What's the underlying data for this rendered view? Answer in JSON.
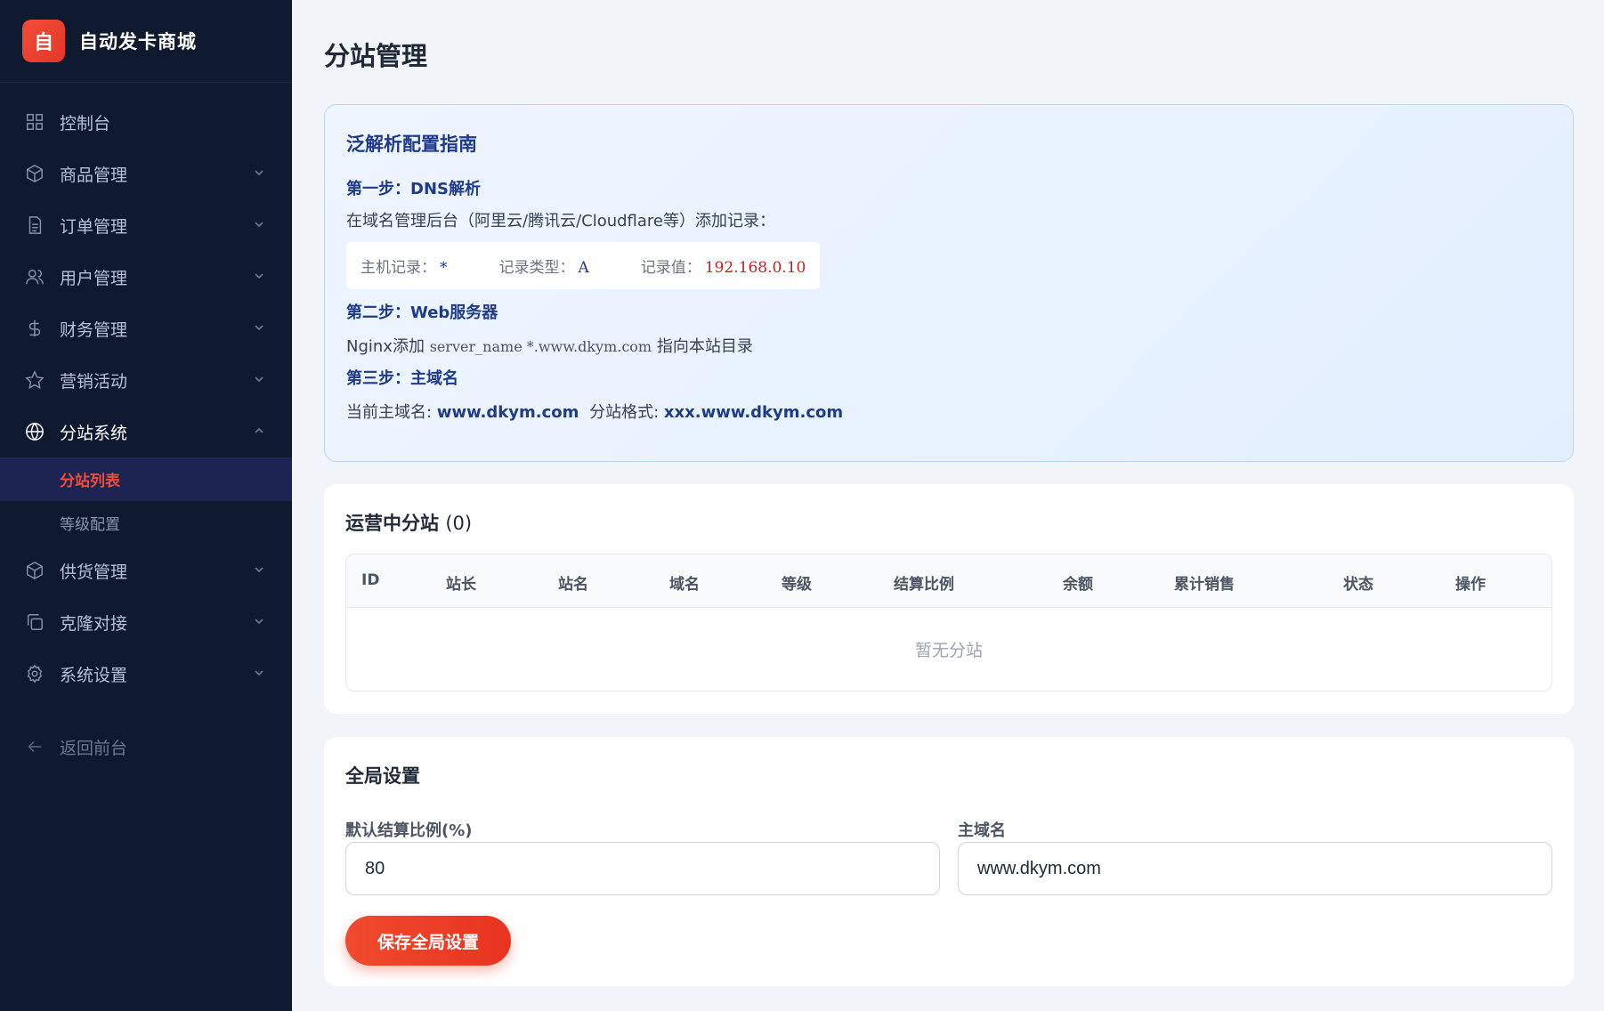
{
  "brand": {
    "logo_char": "自",
    "name": "自动发卡商城"
  },
  "nav": {
    "items": [
      {
        "label": "控制台",
        "icon": "dashboard-icon"
      },
      {
        "label": "商品管理",
        "icon": "box-icon"
      },
      {
        "label": "订单管理",
        "icon": "document-icon"
      },
      {
        "label": "用户管理",
        "icon": "users-icon"
      },
      {
        "label": "财务管理",
        "icon": "dollar-icon"
      },
      {
        "label": "营销活动",
        "icon": "star-icon"
      },
      {
        "label": "分站系统",
        "icon": "globe-icon"
      }
    ],
    "sub_items": [
      "分站列表",
      "等级配置"
    ],
    "items_after": [
      {
        "label": "供货管理",
        "icon": "box-icon"
      },
      {
        "label": "克隆对接",
        "icon": "copy-icon"
      },
      {
        "label": "系统设置",
        "icon": "gear-icon"
      }
    ],
    "back": "返回前台"
  },
  "page": {
    "title": "分站管理"
  },
  "guide": {
    "title": "泛解析配置指南",
    "step1_title": "第一步：DNS解析",
    "step1_desc": "在域名管理后台（阿里云/腾讯云/Cloudflare等）添加记录：",
    "record": {
      "host_label": "主机记录：",
      "host_value": "*",
      "type_label": "记录类型：",
      "type_value": "A",
      "value_label": "记录值：",
      "value_value": "192.168.0.10"
    },
    "step2_title": "第二步：Web服务器",
    "step2_prefix": "Nginx添加",
    "step2_code": "server_name *.www.dkym.com",
    "step2_suffix": "指向本站目录",
    "step3_title": "第三步：主域名",
    "step3_label1": "当前主域名:",
    "step3_value1": "www.dkym.com",
    "step3_label2": "分站格式:",
    "step3_value2": "xxx.www.dkym.com"
  },
  "substations": {
    "title": "运营中分站",
    "count": "(0)",
    "columns": [
      "ID",
      "站长",
      "站名",
      "域名",
      "等级",
      "结算比例",
      "余额",
      "累计销售",
      "状态",
      "操作"
    ],
    "empty_text": "暂无分站"
  },
  "global_settings": {
    "title": "全局设置",
    "ratio_label": "默认结算比例(%)",
    "ratio_value": "80",
    "domain_label": "主域名",
    "domain_value": "www.dkym.com",
    "save_label": "保存全局设置"
  },
  "colors": {
    "accent": "#f24c36",
    "sidebar_bg": "#0f1a30",
    "guide_blue": "#1e3a8a"
  }
}
